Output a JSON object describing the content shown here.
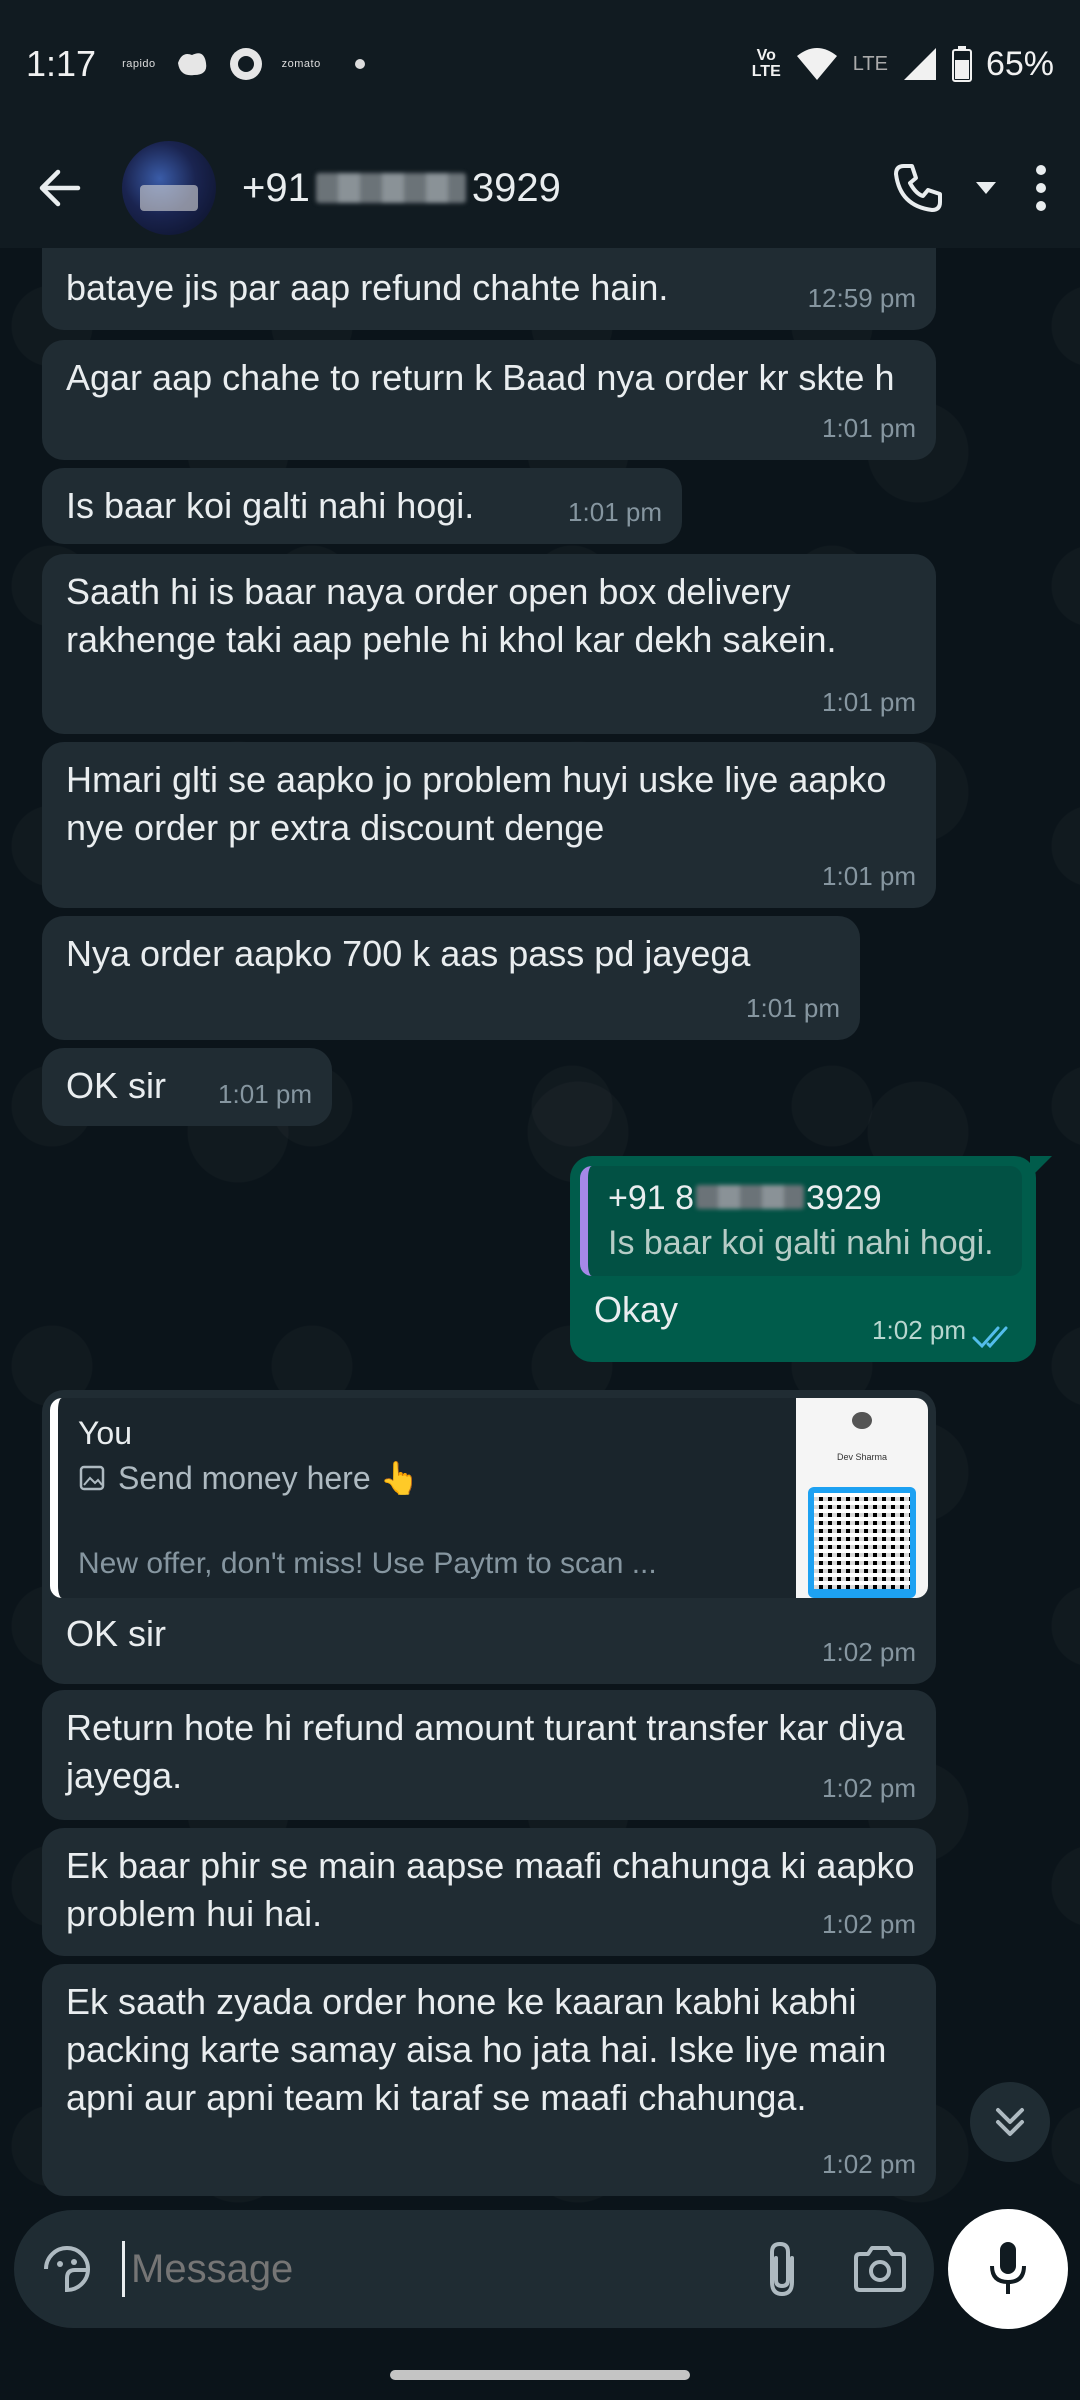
{
  "status_bar": {
    "time": "1:17",
    "notifications": [
      "rapido",
      "zomato"
    ],
    "network_top": "Vo",
    "network_bottom": "LTE",
    "lte_label": "LTE",
    "battery": "65%"
  },
  "header": {
    "name_prefix": "+91",
    "name_suffix": "3929",
    "avatar": "contact-photo"
  },
  "messages": [
    {
      "text": "bataye jis par aap refund chahte hain.",
      "time": "12:59 pm"
    },
    {
      "text": "Agar aap chahe to return k Baad nya order kr skte h",
      "time": "1:01 pm"
    },
    {
      "text": "Is baar koi galti nahi hogi.",
      "time": "1:01 pm"
    },
    {
      "text": "Saath hi is baar naya order open box delivery rakhenge taki aap pehle hi khol kar dekh sakein.",
      "time": "1:01 pm"
    },
    {
      "text": "Hmari glti se aapko jo problem huyi uske liye aapko nye order pr extra discount denge",
      "time": "1:01 pm"
    },
    {
      "text": "Nya order aapko 700 k aas pass pd jayega",
      "time": "1:01 pm"
    },
    {
      "text": "OK sir",
      "time": "1:01 pm"
    },
    {
      "text": "Okay",
      "time": "1:02 pm",
      "quote_name": "+91 8",
      "quote_name_suffix": "3929",
      "quote_text": "Is baar koi galti nahi hogi."
    },
    {
      "text": "OK sir",
      "time": "1:02 pm",
      "reply_author": "You",
      "reply_title": "Send money here 👆",
      "reply_sub": "New offer, don't miss! Use Paytm to scan ...",
      "thumb_name": "Dev Sharma"
    },
    {
      "text": "Return hote hi refund amount turant transfer kar diya jayega.",
      "time": "1:02 pm"
    },
    {
      "text": "Ek baar phir se main aapse maafi chahunga ki aapko problem hui hai.",
      "time": "1:02 pm"
    },
    {
      "text": "Ek saath zyada order hone ke kaaran kabhi kabhi packing karte samay aisa ho jata hai. Iske liye main apni aur apni team ki taraf se maafi chahunga.",
      "time": "1:02 pm"
    }
  ],
  "input": {
    "placeholder": "Message"
  },
  "colors": {
    "incoming": "#202c33",
    "outgoing": "#005c4b",
    "background": "#0b141a",
    "read_ticks": "#53bdeb"
  }
}
